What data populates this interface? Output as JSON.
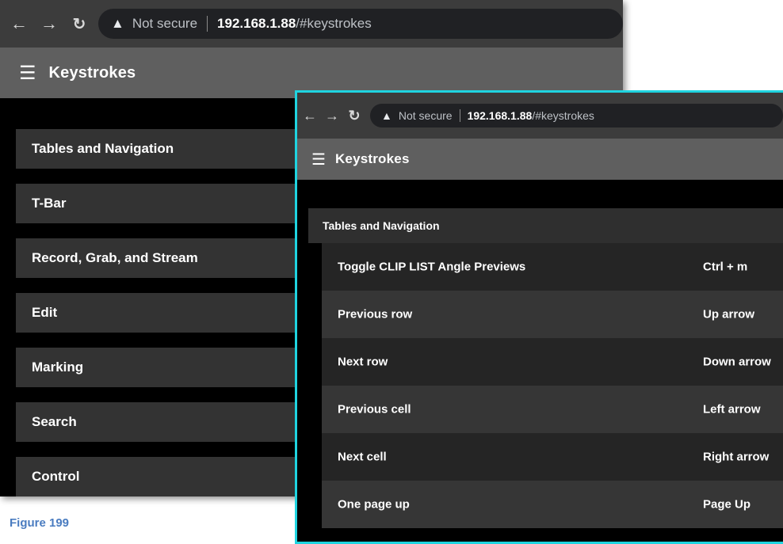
{
  "back_window": {
    "browser": {
      "back_icon": "arrow-left-icon",
      "forward_icon": "arrow-right-icon",
      "reload_icon": "reload-icon",
      "security_icon": "warning-triangle-icon",
      "security_label": "Not secure",
      "url_host": "192.168.1.88",
      "url_path": "/#keystrokes"
    },
    "header": {
      "menu_icon": "hamburger-menu-icon",
      "title": "Keystrokes"
    },
    "categories": [
      "Tables and Navigation",
      "T-Bar",
      "Record, Grab, and Stream",
      "Edit",
      "Marking",
      "Search",
      "Control"
    ]
  },
  "front_window": {
    "browser": {
      "security_label": "Not secure",
      "url_host": "192.168.1.88",
      "url_path": "/#keystrokes"
    },
    "header": {
      "title": "Keystrokes"
    },
    "section_title": "Tables and Navigation",
    "rows": [
      {
        "action": "Toggle CLIP LIST Angle Previews",
        "shortcut": "Ctrl + m"
      },
      {
        "action": "Previous row",
        "shortcut": "Up arrow"
      },
      {
        "action": "Next row",
        "shortcut": "Down arrow"
      },
      {
        "action": "Previous cell",
        "shortcut": "Left arrow"
      },
      {
        "action": "Next cell",
        "shortcut": "Right arrow"
      },
      {
        "action": "One page up",
        "shortcut": "Page Up"
      }
    ],
    "border_color": "#1fd4e0"
  },
  "caption": "Figure 199"
}
